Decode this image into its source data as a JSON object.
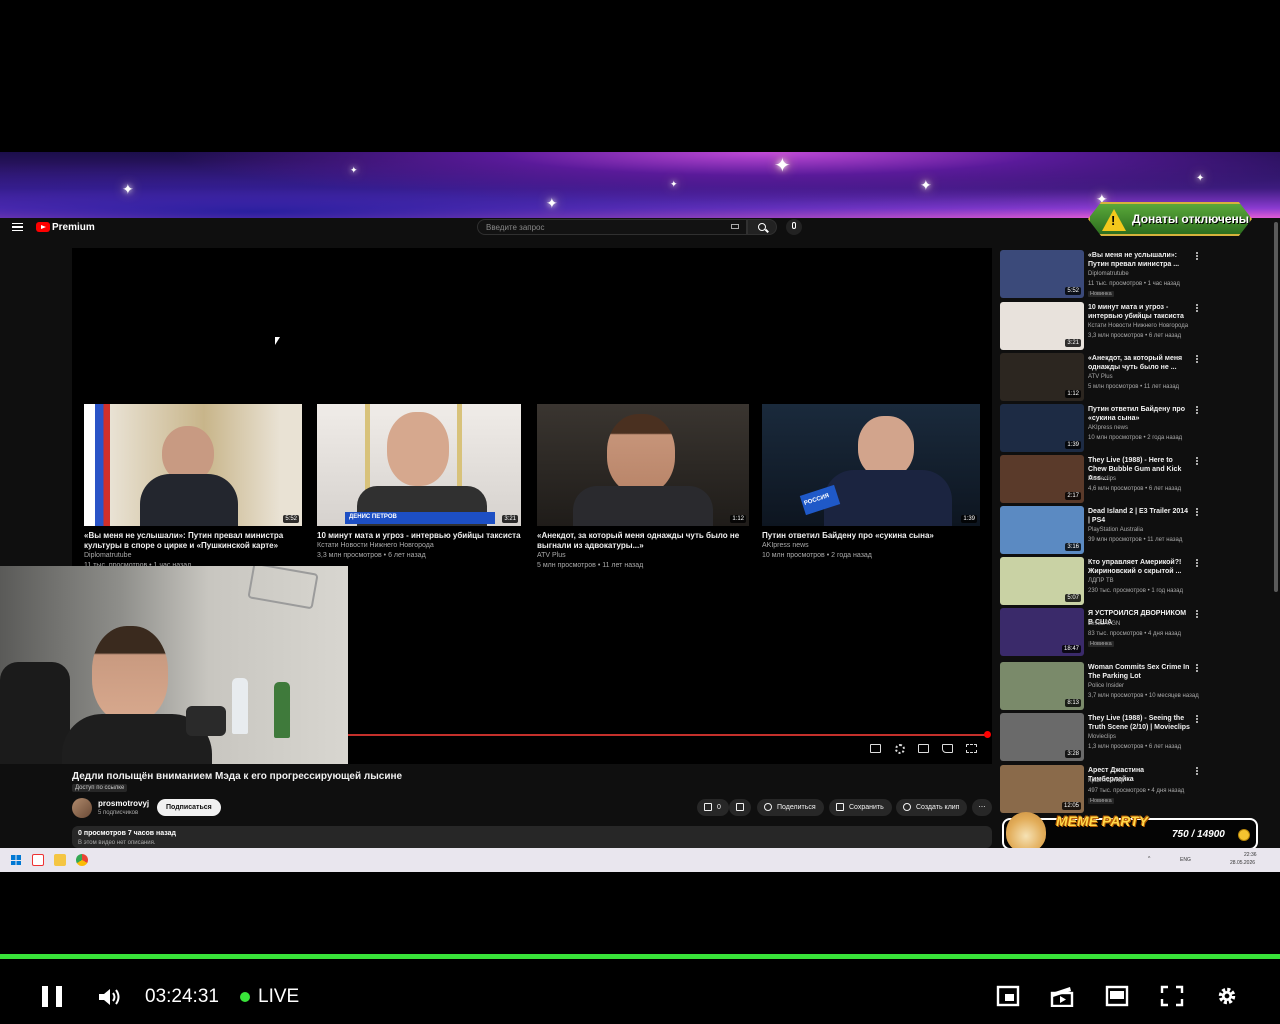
{
  "banner": {
    "donate_text": "Донаты отключены"
  },
  "youtube": {
    "brand": "Premium",
    "search_placeholder": "Введите запрос",
    "end_cards": [
      {
        "title": "«Вы меня не услышали»: Путин превал министра культуры в споре о цирке и «Пушкинской карте»",
        "channel": "Diplomatrutube",
        "meta": "11 тыс. просмотров • 1 час назад",
        "duration": "5:52"
      },
      {
        "title": "10 минут мата и угроз - интервью убийцы таксиста",
        "channel": "Кстати Новости Нижнего Новгорода",
        "meta": "3,3 млн просмотров • 6 лет назад",
        "duration": "3:21",
        "caption": "ДЕНИС ПЕТРОВ"
      },
      {
        "title": "«Анекдот, за который меня однажды чуть было не выгнали из адвокатуры...»",
        "channel": "ATV Plus",
        "meta": "5 млн просмотров • 11 лет назад",
        "duration": "1:12"
      },
      {
        "title": "Путин ответил Байдену про «сукина сына»",
        "channel": "AKIpress news",
        "meta": "10 млн просмотров • 2 года назад",
        "duration": "1:39",
        "caption": "РОССИЯ"
      }
    ],
    "video": {
      "title": "Дедли полыщён вниманием Мэда к его прогрессирующей лысине",
      "access": "Доступ по ссылке",
      "channel": "prosmotrovyj",
      "subscribers": "5 подписчиков",
      "subscribe_label": "Подписаться",
      "likes": "0",
      "share_label": "Поделиться",
      "save_label": "Сохранить",
      "clip_label": "Создать клип",
      "views_line": "0 просмотров  7 часов назад",
      "description": "В этом видео нет описания."
    },
    "sidebar": [
      {
        "title": "«Вы меня не услышали»: Путин превал министра ...",
        "channel": "Diplomatrutube",
        "meta": "11 тыс. просмотров • 1 час назад",
        "duration": "5:52",
        "badge": "Новинка"
      },
      {
        "title": "10 минут мата и угроз - интервью убийцы таксиста",
        "channel": "Кстати Новости Нижнего Новгорода",
        "meta": "3,3 млн просмотров • 6 лет назад",
        "duration": "3:21",
        "badge": ""
      },
      {
        "title": "«Анекдот, за который меня однажды чуть было не ...",
        "channel": "ATV Plus",
        "meta": "5 млн просмотров • 11 лет назад",
        "duration": "1:12",
        "badge": ""
      },
      {
        "title": "Путин ответил Байдену про «сукина сына»",
        "channel": "AKIpress news",
        "meta": "10 млн просмотров • 2 года назад",
        "duration": "1:39",
        "badge": ""
      },
      {
        "title": "They Live (1988) - Here to Chew Bubble Gum and Kick Ass ...",
        "channel": "Movieclips",
        "meta": "4,6 млн просмотров • 6 лет назад",
        "duration": "2:17",
        "badge": ""
      },
      {
        "title": "Dead Island 2 | E3 Trailer 2014 | PS4",
        "channel": "PlayStation Australia",
        "meta": "39 млн просмотров • 11 лет назад",
        "duration": "3:16",
        "badge": ""
      },
      {
        "title": "Кто управляет Америкой?! Жириновский о скрытой ...",
        "channel": "ЛДПР ТВ",
        "meta": "230 тыс. просмотров • 1 год назад",
        "duration": "5:07",
        "badge": ""
      },
      {
        "title": "Я УСТРОИЛСЯ ДВОРНИКОМ В США",
        "channel": "JesusAVGN",
        "meta": "83 тыс. просмотров • 4 дня назад",
        "duration": "18:47",
        "badge": "Новинка"
      },
      {
        "title": "Woman Commits Sex Crime In The Parking Lot",
        "channel": "Police Insider",
        "meta": "3,7 млн просмотров • 10 месяцев назад",
        "duration": "8:13",
        "badge": ""
      },
      {
        "title": "They Live (1988) - Seeing the Truth Scene (2/10) | Movieclips",
        "channel": "Movieclips",
        "meta": "1,3 млн просмотров • 6 лет назад",
        "duration": "3:28",
        "badge": ""
      },
      {
        "title": "Арест Джастина Тимберлейка",
        "channel": "КрайтХантер",
        "meta": "497 тыс. просмотров • 4 дня назад",
        "duration": "12:05",
        "badge": "Новинка"
      }
    ]
  },
  "meme_party": {
    "title": "MEME PARTY",
    "count": "750 / 14900"
  },
  "taskbar": {
    "lang": "ENG",
    "time": "22:36",
    "date": "28.05.2026"
  },
  "stream_controls": {
    "time": "03:24:31",
    "live_label": "LIVE"
  },
  "colors": {
    "accent_green": "#39e33a",
    "yt_red": "#ff0000",
    "coin": "#f4c430"
  }
}
